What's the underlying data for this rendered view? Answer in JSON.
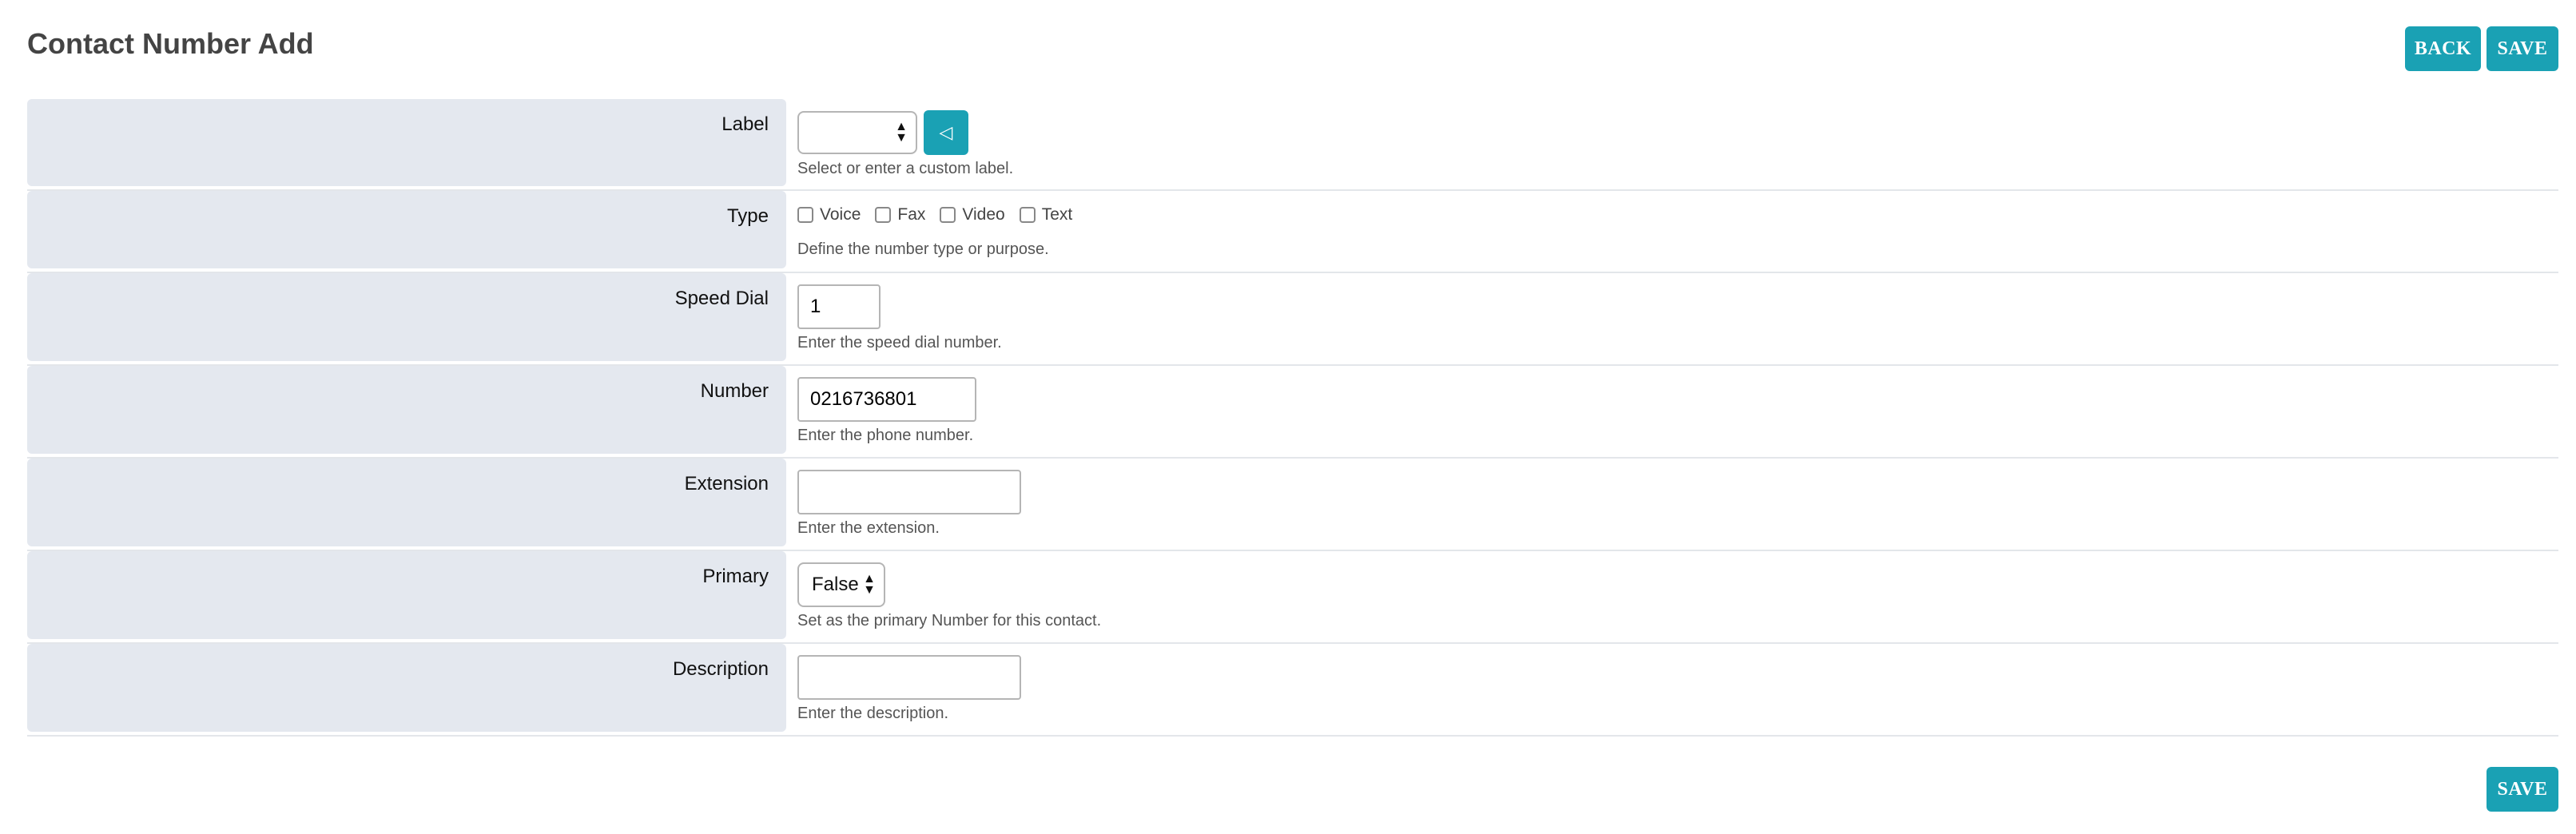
{
  "page": {
    "title": "Contact Number Add"
  },
  "toolbar": {
    "back_label": "BACK",
    "save_label": "SAVE"
  },
  "footer": {
    "save_label": "SAVE"
  },
  "form": {
    "label": {
      "label": "Label",
      "value": "",
      "help": "Select or enter a custom label."
    },
    "type": {
      "label": "Type",
      "options": [
        "Voice",
        "Fax",
        "Video",
        "Text"
      ],
      "help": "Define the number type or purpose."
    },
    "speed_dial": {
      "label": "Speed Dial",
      "value": "1",
      "help": "Enter the speed dial number."
    },
    "number": {
      "label": "Number",
      "value": "0216736801",
      "help": "Enter the phone number."
    },
    "extension": {
      "label": "Extension",
      "value": "",
      "help": "Enter the extension."
    },
    "primary": {
      "label": "Primary",
      "value": "False",
      "help": "Set as the primary Number for this contact."
    },
    "description": {
      "label": "Description",
      "value": "",
      "help": "Enter the description."
    }
  },
  "colors": {
    "accent": "#1aa1b4",
    "label_bg": "#e4e8ef"
  }
}
